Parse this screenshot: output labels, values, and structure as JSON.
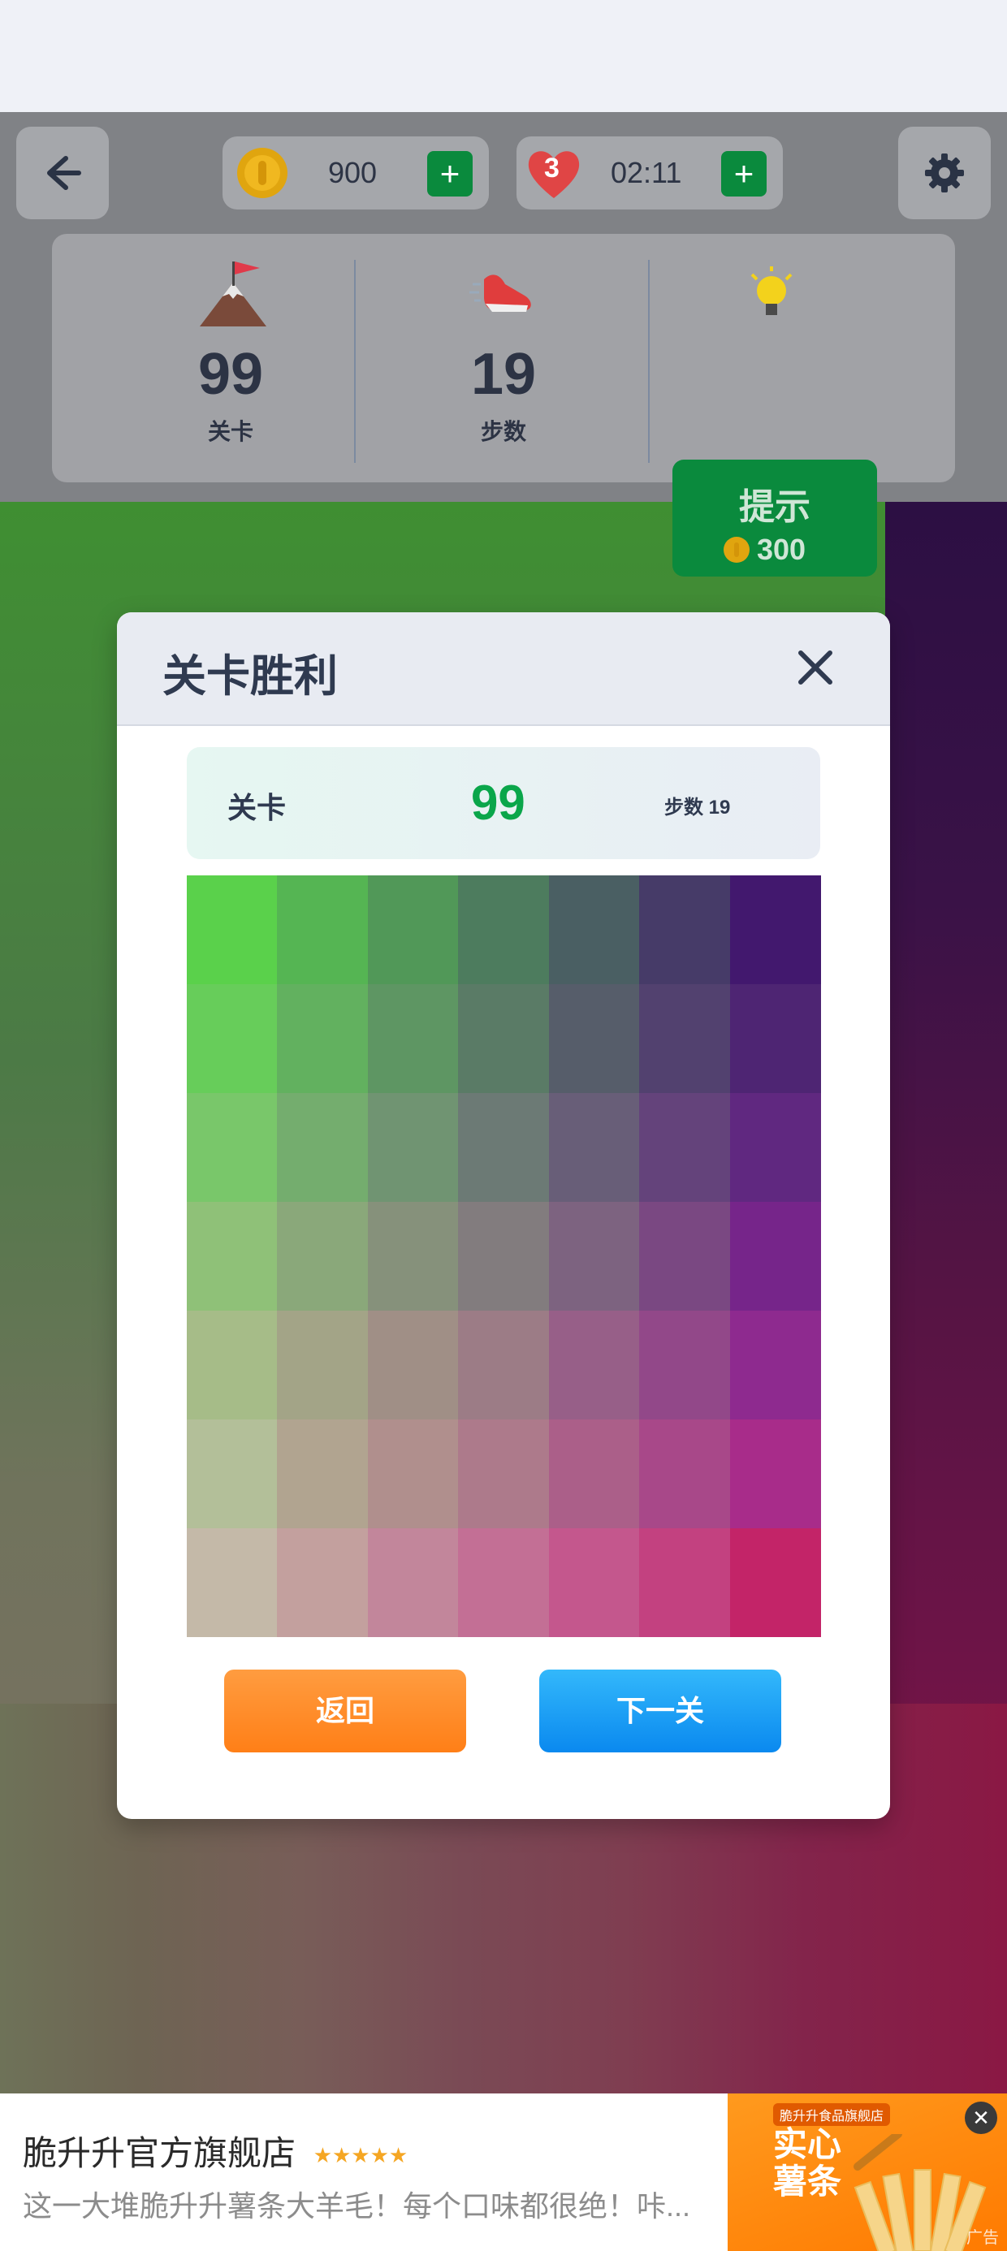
{
  "top": {
    "coins": "900",
    "lives": "3",
    "timer": "02:11",
    "add": "+"
  },
  "stats": {
    "level_value": "99",
    "level_label": "关卡",
    "steps_value": "19",
    "steps_label": "步数",
    "hint_label": "提示",
    "hint_cost": "300"
  },
  "modal": {
    "title": "关卡胜利",
    "level_label": "关卡",
    "level_value": "99",
    "steps_text": "步数 19",
    "back_label": "返回",
    "next_label": "下一关"
  },
  "grid_colors": [
    [
      "#5ad14b",
      "#55b553",
      "#519858",
      "#4d7c5e",
      "#4a5f63",
      "#463b68",
      "#42186e"
    ],
    [
      "#67cd5a",
      "#62b15f",
      "#5e9663",
      "#5a7b66",
      "#565d6a",
      "#52416f",
      "#4e2573"
    ],
    [
      "#79c76a",
      "#74ad6e",
      "#709472",
      "#6c7a75",
      "#685e78",
      "#64437b",
      "#602880"
    ],
    [
      "#8fc178",
      "#8aa87a",
      "#86917b",
      "#827c7e",
      "#7d6380",
      "#7a4882",
      "#76258a"
    ],
    [
      "#a6bc88",
      "#a3a487",
      "#a08f86",
      "#9c7c86",
      "#975f88",
      "#924889",
      "#8e2a8f"
    ],
    [
      "#b3bf99",
      "#b1a490",
      "#b08f8d",
      "#ad7a8b",
      "#ab5f89",
      "#a84889",
      "#a82c8a"
    ],
    [
      "#c4b9a8",
      "#c3a09e",
      "#c2869b",
      "#c36f95",
      "#c4578d",
      "#c34180",
      "#c32468"
    ]
  ],
  "ad": {
    "title": "脆升升官方旗舰店",
    "description": "这一大堆脆升升薯条大羊毛！每个口味都很绝！咔...",
    "image_text": "实心薯条",
    "badge": "脆升升食品旗舰店",
    "ad_label": "广告"
  }
}
